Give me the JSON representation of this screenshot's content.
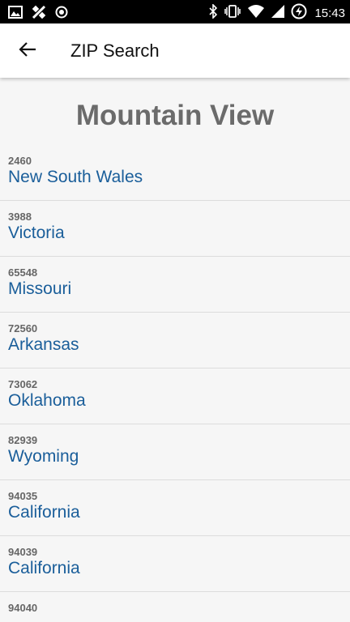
{
  "status_bar": {
    "time": "15:43",
    "left_icons": [
      "image-icon",
      "satellite-icon",
      "record-icon"
    ],
    "right_icons": [
      "bluetooth-icon",
      "vibrate-icon",
      "wifi-icon",
      "signal-icon",
      "battery-icon"
    ]
  },
  "appbar": {
    "title": "ZIP Search",
    "back_icon": "arrow-left-icon"
  },
  "city": "Mountain View",
  "results": [
    {
      "zip": "2460",
      "state": "New South Wales"
    },
    {
      "zip": "3988",
      "state": "Victoria"
    },
    {
      "zip": "65548",
      "state": "Missouri"
    },
    {
      "zip": "72560",
      "state": "Arkansas"
    },
    {
      "zip": "73062",
      "state": "Oklahoma"
    },
    {
      "zip": "82939",
      "state": "Wyoming"
    },
    {
      "zip": "94035",
      "state": "California"
    },
    {
      "zip": "94039",
      "state": "California"
    },
    {
      "zip": "94040",
      "state": ""
    }
  ],
  "colors": {
    "state_link": "#1a5e9a",
    "zip_text": "#666666",
    "city_title": "#6b6b6b",
    "background": "#f6f6f6"
  }
}
